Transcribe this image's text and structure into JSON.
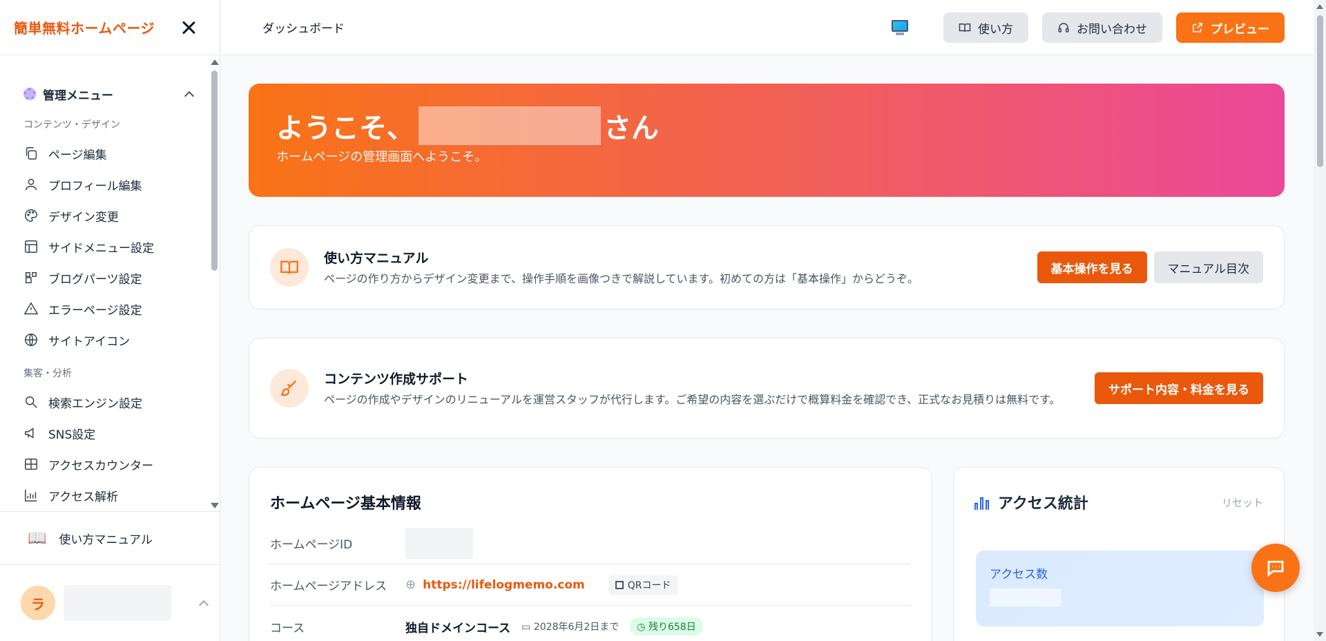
{
  "sidebar": {
    "brand": "簡単無料ホームページ",
    "section_title": "管理メニュー",
    "groups": [
      "コンテンツ・デザイン",
      "集客・分析"
    ],
    "items": [
      {
        "label": "ページ編集",
        "icon": "copy-icon"
      },
      {
        "label": "プロフィール編集",
        "icon": "user-icon"
      },
      {
        "label": "デザイン変更",
        "icon": "palette-icon"
      },
      {
        "label": "サイドメニュー設定",
        "icon": "layout-icon"
      },
      {
        "label": "ブログパーツ設定",
        "icon": "blocks-icon"
      },
      {
        "label": "エラーページ設定",
        "icon": "warning-icon"
      },
      {
        "label": "サイトアイコン",
        "icon": "globe-icon"
      },
      {
        "label": "検索エンジン設定",
        "icon": "search-icon"
      },
      {
        "label": "SNS設定",
        "icon": "megaphone-icon"
      },
      {
        "label": "アクセスカウンター",
        "icon": "grid-icon"
      },
      {
        "label": "アクセス解析",
        "icon": "chart-icon"
      }
    ],
    "manual_label": "使い方マニュアル",
    "user_initial": "ラ"
  },
  "topbar": {
    "breadcrumb": "ダッシュボード",
    "howto_label": "使い方",
    "contact_label": "お問い合わせ",
    "preview_label": "プレビュー"
  },
  "hero": {
    "greeting": "ようこそ、",
    "suffix": "さん",
    "subtitle": "ホームページの管理画面へようこそ。"
  },
  "manual_card": {
    "title": "使い方マニュアル",
    "desc": "ページの作り方からデザイン変更まで、操作手順を画像つきで解説しています。初めての方は「基本操作」からどうぞ。",
    "primary_btn": "基本操作を見る",
    "secondary_btn": "マニュアル目次"
  },
  "support_card": {
    "title": "コンテンツ作成サポート",
    "desc": "ページの作成やデザインのリニューアルを運営スタッフが代行します。ご希望の内容を選ぶだけで概算料金を確認でき、正式なお見積りは無料です。",
    "btn": "サポート内容・料金を見る"
  },
  "info": {
    "title": "ホームページ基本情報",
    "id_label": "ホームページID",
    "address_label": "ホームページアドレス",
    "url": "https://lifelogmemo.com",
    "qr_label": "QRコード",
    "course_label": "コース",
    "course_name": "独自ドメインコース",
    "expiry": "2028年6月2日まで",
    "remaining": "残り658日"
  },
  "stats": {
    "title": "アクセス統計",
    "reset_label": "リセット",
    "access_label": "アクセス数"
  },
  "colors": {
    "accent": "#f97316",
    "accent_dark": "#ea580c",
    "hero_start": "#f97316",
    "hero_end": "#ec4899"
  }
}
